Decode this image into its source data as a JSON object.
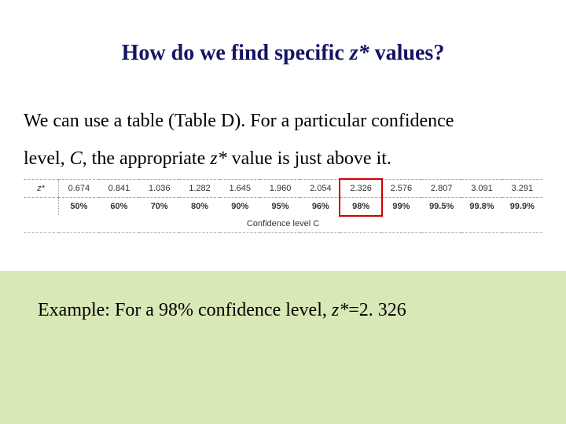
{
  "title": {
    "pre": "How do we find specific ",
    "zstar": "z*",
    "post": " values?"
  },
  "body": {
    "l1a": "We can use a table (Table D). For a particular confidence",
    "l2a": "level, ",
    "l2_C": "C",
    "l2b": ", the appropriate ",
    "l2_zstar": "z*",
    "l2c": " value is just above it."
  },
  "table": {
    "row_label_z": "z*",
    "zvals": [
      "0.674",
      "0.841",
      "1.036",
      "1.282",
      "1.645",
      "1.960",
      "2.054",
      "2.326",
      "2.576",
      "2.807",
      "3.091",
      "3.291"
    ],
    "cvals": [
      "50%",
      "60%",
      "70%",
      "80%",
      "90%",
      "95%",
      "96%",
      "98%",
      "99%",
      "99.5%",
      "99.8%",
      "99.9%"
    ],
    "caption": "Confidence level C",
    "highlight_index": 7
  },
  "example": {
    "pre": "Example: For a 98% confidence level, ",
    "zstar": "z*",
    "post": "=2. 326"
  }
}
